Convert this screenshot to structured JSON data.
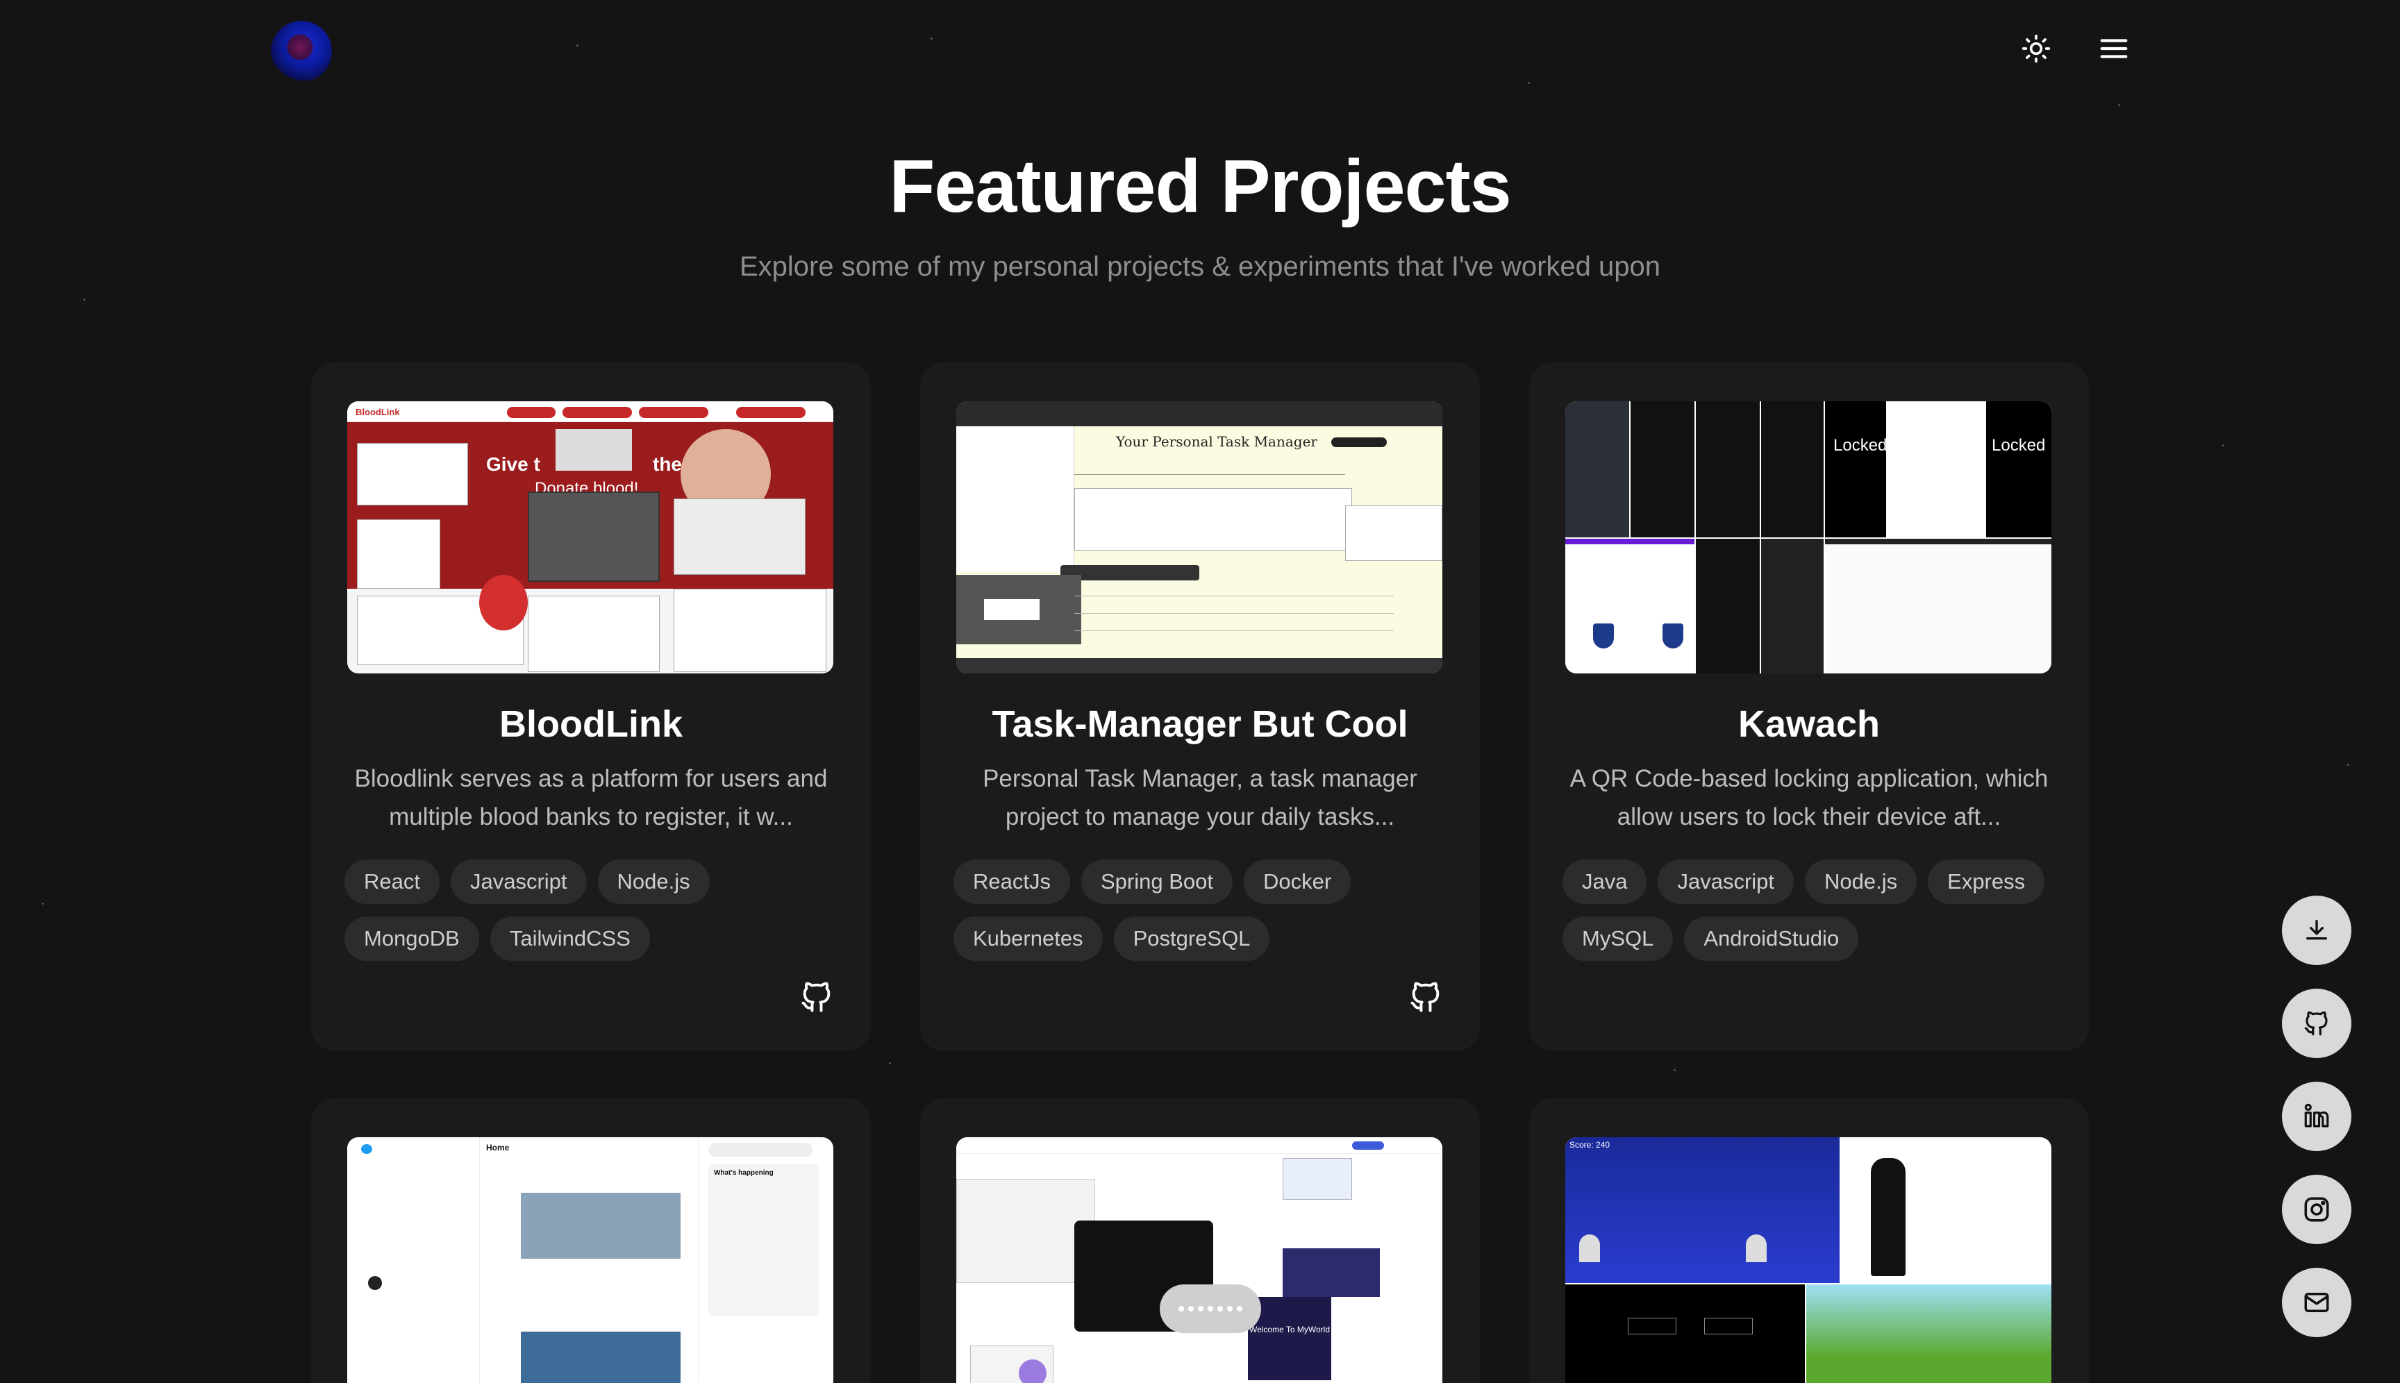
{
  "header": {
    "logo_icon": "planet-logo-icon",
    "theme_toggle_icon": "sun-icon",
    "menu_icon": "hamburger-menu-icon"
  },
  "section": {
    "title": "Featured Projects",
    "subtitle": "Explore some of my personal projects & experiments that I've worked upon"
  },
  "projects": [
    {
      "title": "BloodLink",
      "description": "Bloodlink serves as a platform for users and multiple blood banks to register, it w...",
      "tags": [
        "React",
        "Javascript",
        "Node.js",
        "MongoDB",
        "TailwindCSS"
      ],
      "repo_icon": "github-icon"
    },
    {
      "title": "Task-Manager But Cool",
      "description": "Personal Task Manager, a task manager project to manage your daily tasks...",
      "tags": [
        "ReactJs",
        "Spring Boot",
        "Docker",
        "Kubernetes",
        "PostgreSQL"
      ],
      "repo_icon": "github-icon"
    },
    {
      "title": "Kawach",
      "description": "A QR Code-based locking application, which allow users to lock their device aft...",
      "tags": [
        "Java",
        "Javascript",
        "Node.js",
        "Express",
        "MySQL",
        "AndroidStudio"
      ],
      "repo_icon": "github-icon"
    }
  ],
  "thumb_text": {
    "bloodlink_brand": "BloodLink",
    "bloodlink_hero": "Give t",
    "bloodlink_hero2": "thers.",
    "bloodlink_donate": "Donate blood!",
    "task_heading": "Your Personal Task Manager",
    "kawach_locked": "Locked",
    "twitter_home": "Home",
    "twitter_happening": "What's happening",
    "game_score": "Score: 240",
    "myworld": "Welcome To MyWorld"
  },
  "side_links": [
    {
      "name": "resume-download",
      "icon": "download-icon"
    },
    {
      "name": "github-link",
      "icon": "github-icon"
    },
    {
      "name": "linkedin-link",
      "icon": "linkedin-icon"
    },
    {
      "name": "instagram-link",
      "icon": "instagram-icon"
    },
    {
      "name": "email-link",
      "icon": "mail-icon"
    }
  ],
  "colors": {
    "background": "#141414",
    "card": "#1b1b1b",
    "tag": "#2c2c2c",
    "subtitle": "#8e8e8e",
    "side_button": "#d9d9d9"
  }
}
